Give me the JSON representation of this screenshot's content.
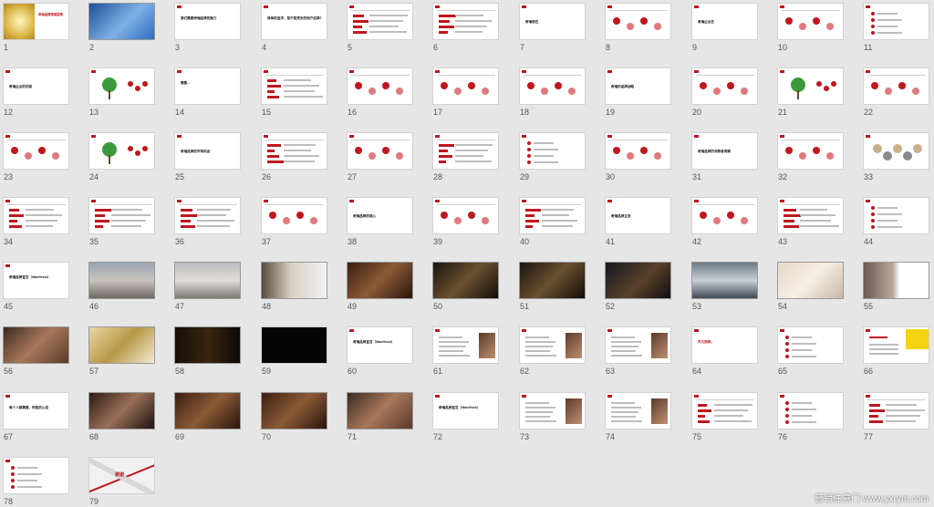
{
  "watermark": "营销注意门 www.yxrym.com",
  "colors": {
    "accent": "#c0161e",
    "bg": "#e6e6e6"
  },
  "slides": [
    {
      "n": "1",
      "kind": "cover",
      "text": "奇瑞品牌策略提案"
    },
    {
      "n": "2",
      "kind": "photo-blue"
    },
    {
      "n": "3",
      "kind": "text",
      "text": "我们需要奇瑞品牌的魅力"
    },
    {
      "n": "4",
      "kind": "text",
      "text": "简单的追求，是不是更多的用户选择？"
    },
    {
      "n": "5",
      "kind": "chart"
    },
    {
      "n": "6",
      "kind": "chart"
    },
    {
      "n": "7",
      "kind": "section",
      "text": "奇瑞现在"
    },
    {
      "n": "8",
      "kind": "diagram"
    },
    {
      "n": "9",
      "kind": "section",
      "text": "奇瑞企业史"
    },
    {
      "n": "10",
      "kind": "diagram"
    },
    {
      "n": "11",
      "kind": "redlist"
    },
    {
      "n": "12",
      "kind": "section",
      "text": "奇瑞企业的历程"
    },
    {
      "n": "13",
      "kind": "tree"
    },
    {
      "n": "14",
      "kind": "text",
      "text": "需要..."
    },
    {
      "n": "15",
      "kind": "chart"
    },
    {
      "n": "16",
      "kind": "diagram"
    },
    {
      "n": "17",
      "kind": "diagram"
    },
    {
      "n": "18",
      "kind": "diagram"
    },
    {
      "n": "19",
      "kind": "section",
      "text": "奇瑞的品牌战略"
    },
    {
      "n": "20",
      "kind": "diagram"
    },
    {
      "n": "21",
      "kind": "tree"
    },
    {
      "n": "22",
      "kind": "diagram"
    },
    {
      "n": "23",
      "kind": "diagram"
    },
    {
      "n": "24",
      "kind": "tree"
    },
    {
      "n": "25",
      "kind": "section",
      "text": "奇瑞品牌的市场机会"
    },
    {
      "n": "26",
      "kind": "chart"
    },
    {
      "n": "27",
      "kind": "diagram"
    },
    {
      "n": "28",
      "kind": "chart"
    },
    {
      "n": "29",
      "kind": "redlist"
    },
    {
      "n": "30",
      "kind": "diagram"
    },
    {
      "n": "31",
      "kind": "section",
      "text": "奇瑞品牌的消费者洞察"
    },
    {
      "n": "32",
      "kind": "diagram"
    },
    {
      "n": "33",
      "kind": "circles"
    },
    {
      "n": "34",
      "kind": "chart"
    },
    {
      "n": "35",
      "kind": "chart"
    },
    {
      "n": "36",
      "kind": "chart"
    },
    {
      "n": "37",
      "kind": "diagram"
    },
    {
      "n": "38",
      "kind": "section",
      "text": "奇瑞品牌的核心"
    },
    {
      "n": "39",
      "kind": "diagram"
    },
    {
      "n": "40",
      "kind": "chart"
    },
    {
      "n": "41",
      "kind": "section",
      "text": "奇瑞品牌主张"
    },
    {
      "n": "42",
      "kind": "diagram"
    },
    {
      "n": "43",
      "kind": "chart"
    },
    {
      "n": "44",
      "kind": "redlist"
    },
    {
      "n": "45",
      "kind": "text",
      "text": "奇瑞品牌宣言（Manifesto）"
    },
    {
      "n": "46",
      "kind": "photo-city"
    },
    {
      "n": "47",
      "kind": "photo-street"
    },
    {
      "n": "48",
      "kind": "photo-people"
    },
    {
      "n": "49",
      "kind": "photo-warm"
    },
    {
      "n": "50",
      "kind": "photo-dark"
    },
    {
      "n": "51",
      "kind": "photo-dark"
    },
    {
      "n": "52",
      "kind": "photo-night"
    },
    {
      "n": "53",
      "kind": "photo-car"
    },
    {
      "n": "54",
      "kind": "photo-light"
    },
    {
      "n": "55",
      "kind": "photo-mixed"
    },
    {
      "n": "56",
      "kind": "photo-group"
    },
    {
      "n": "57",
      "kind": "photo-gold"
    },
    {
      "n": "58",
      "kind": "photo-bottle"
    },
    {
      "n": "59",
      "kind": "black"
    },
    {
      "n": "60",
      "kind": "text",
      "text": "奇瑞品牌宣言（Manifesto）"
    },
    {
      "n": "61",
      "kind": "textphoto"
    },
    {
      "n": "62",
      "kind": "textphoto"
    },
    {
      "n": "63",
      "kind": "textphoto"
    },
    {
      "n": "64",
      "kind": "redtext",
      "text": "平凡而奇。"
    },
    {
      "n": "65",
      "kind": "redlist"
    },
    {
      "n": "66",
      "kind": "yellow"
    },
    {
      "n": "67",
      "kind": "text",
      "text": "每个人都需要，积极的心态"
    },
    {
      "n": "68",
      "kind": "photo-face"
    },
    {
      "n": "69",
      "kind": "photo-warm"
    },
    {
      "n": "70",
      "kind": "photo-warm"
    },
    {
      "n": "71",
      "kind": "photo-group"
    },
    {
      "n": "72",
      "kind": "text",
      "text": "奇瑞品牌宣言（Manifesto）"
    },
    {
      "n": "73",
      "kind": "textphoto"
    },
    {
      "n": "74",
      "kind": "textphoto"
    },
    {
      "n": "75",
      "kind": "chart"
    },
    {
      "n": "76",
      "kind": "redlist"
    },
    {
      "n": "77",
      "kind": "chart"
    },
    {
      "n": "78",
      "kind": "redlist"
    },
    {
      "n": "79",
      "kind": "finale",
      "text": "谢谢"
    }
  ]
}
